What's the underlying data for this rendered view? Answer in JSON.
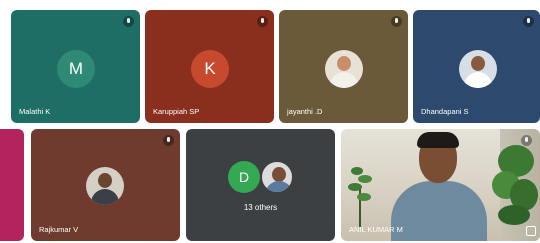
{
  "participants": [
    {
      "name": "Malathi K",
      "initial": "M",
      "tile_color": "#1e6e66",
      "avatar_color": "#2e8a74"
    },
    {
      "name": "Karuppiah SP",
      "initial": "K",
      "tile_color": "#8a2e1e",
      "avatar_color": "#c84a2e"
    },
    {
      "name": "jayanthi .D",
      "initial": "",
      "tile_color": "#6b5a3a",
      "avatar_color": "#e8e2d6"
    },
    {
      "name": "Dhandapani S",
      "initial": "",
      "tile_color": "#2d4a6e",
      "avatar_color": "#d7dfe6"
    },
    {
      "name": "Rajkumar V",
      "initial": "",
      "tile_color": "#6e3b2e",
      "avatar_color": "#d5d0c6"
    },
    {
      "name": "ANIL KUMAR M",
      "initial": "",
      "tile_color": "#d8d2c4",
      "avatar_color": ""
    }
  ],
  "others": {
    "label": "13 others",
    "initial": "D",
    "tile_color": "#3c4043",
    "avatar_color": "#34a853"
  },
  "edge_tile_color": "#b3245e",
  "icons": [
    "mic-off-icon",
    "pin-icon"
  ]
}
